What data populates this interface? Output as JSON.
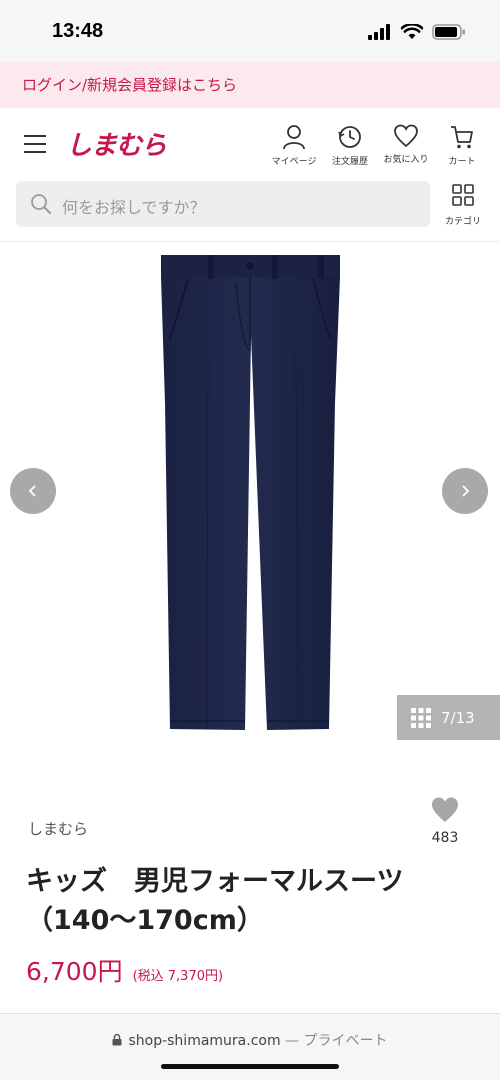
{
  "status_bar": {
    "time": "13:48"
  },
  "login_banner": {
    "text": "ログイン/新規会員登録はこちら"
  },
  "header": {
    "logo_text": "しまむら",
    "actions": [
      {
        "label": "マイページ",
        "icon": "person-icon"
      },
      {
        "label": "注文履歴",
        "icon": "history-icon"
      },
      {
        "label": "お気に入り",
        "icon": "heart-icon"
      },
      {
        "label": "カート",
        "icon": "cart-icon"
      }
    ],
    "search": {
      "placeholder": "何をお探しですか？"
    },
    "category": {
      "label": "カテゴリ"
    }
  },
  "gallery": {
    "counter": "7/13",
    "current_index": 7,
    "total_images": 13
  },
  "product": {
    "brand": "しまむら",
    "favorite_count": "483",
    "title": "キッズ　男児フォーマルスーツ（140〜170cm）",
    "price": "6,700円",
    "price_tax": "(税込 7,370円)"
  },
  "browser": {
    "domain": "shop-shimamura.com",
    "mode": " — プライベート"
  },
  "colors": {
    "brand_red": "#c8174a",
    "banner_bg": "#fbe9ee",
    "pants_navy": "#1d2446"
  }
}
